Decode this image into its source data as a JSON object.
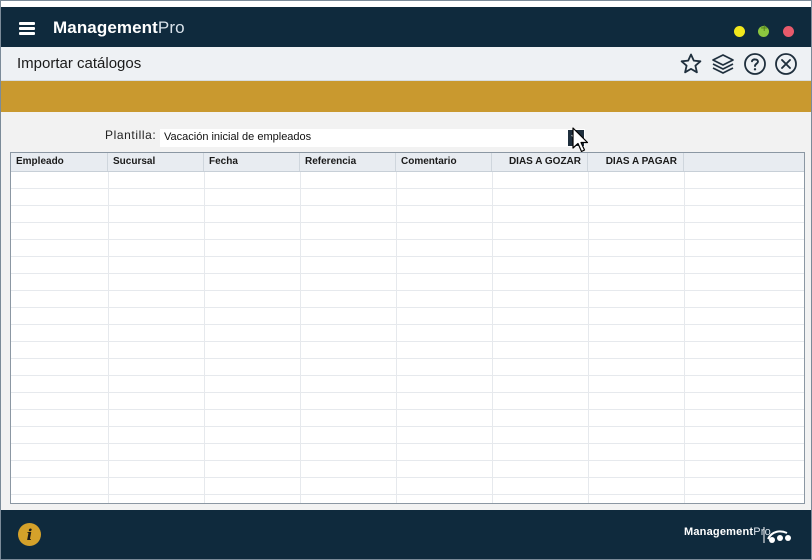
{
  "app": {
    "title_bold": "Management",
    "title_light": "Pro",
    "footer_bold": "Management",
    "footer_light": "Pro"
  },
  "header": {
    "title": "Importar catálogos"
  },
  "form": {
    "template_label": "Plantilla:",
    "template_value": "Vacación inicial de empleados"
  },
  "table": {
    "columns": [
      {
        "label": "Empleado"
      },
      {
        "label": "Sucursal"
      },
      {
        "label": "Fecha"
      },
      {
        "label": "Referencia"
      },
      {
        "label": "Comentario"
      },
      {
        "label": "DIAS A GOZAR"
      },
      {
        "label": "DIAS A PAGAR"
      }
    ],
    "rows": []
  },
  "colors": {
    "titlebar": "#0f2a3d",
    "gold": "#c9992f",
    "min": "#f2e71c",
    "max": "#8cc63f",
    "close": "#e85a6b"
  },
  "icons": {
    "menu": "hamburger-icon",
    "favorite": "star-icon",
    "layers": "layers-icon",
    "help": "help-icon",
    "close": "close-circle-icon",
    "info": "info-icon",
    "dropdown": "chevron-down-icon"
  }
}
